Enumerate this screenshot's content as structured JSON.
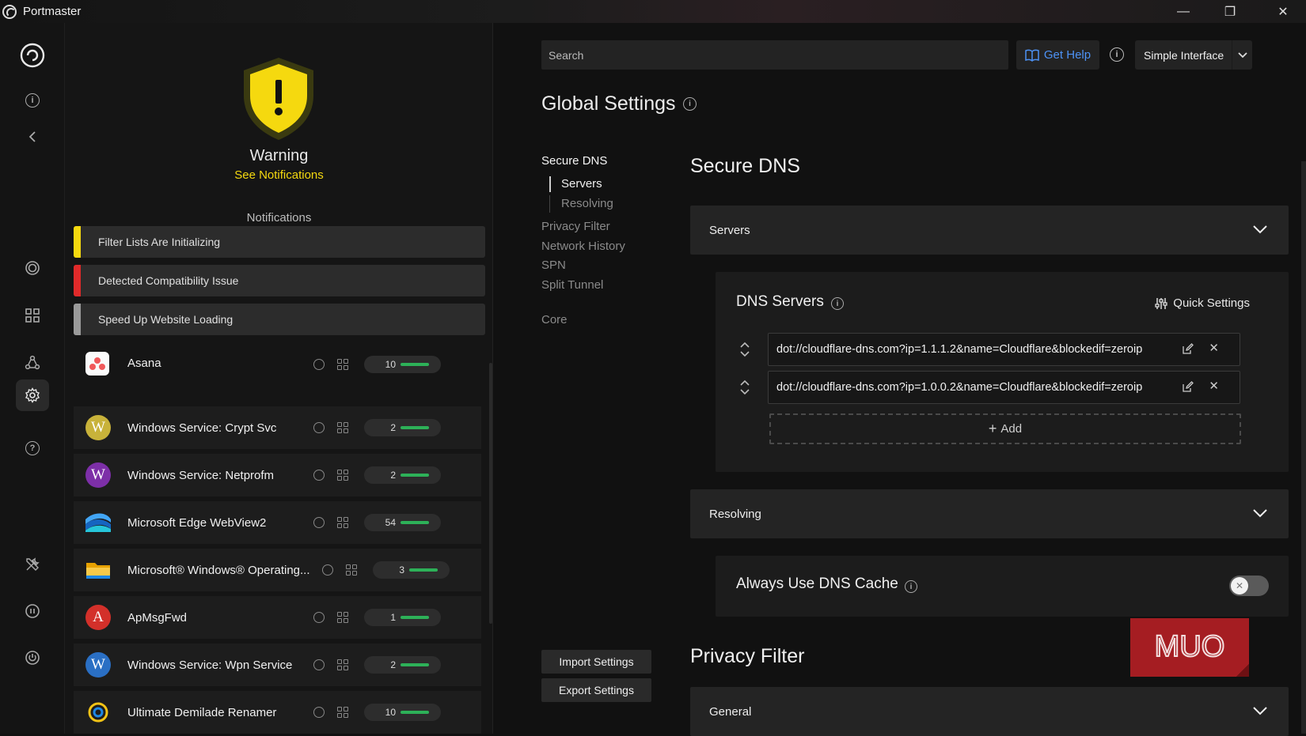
{
  "window": {
    "title": "Portmaster",
    "minimize": "—",
    "maximize": "❐",
    "close": "✕"
  },
  "rail": {
    "items": [
      {
        "name": "portmaster-logo-icon"
      },
      {
        "name": "info-icon"
      },
      {
        "name": "collapse-chevron-icon"
      },
      {
        "name": "monitor-icon"
      },
      {
        "name": "apps-icon"
      },
      {
        "name": "spn-icon"
      },
      {
        "name": "settings-gear-icon"
      },
      {
        "name": "help-icon"
      },
      {
        "name": "tools-icon"
      },
      {
        "name": "pause-icon"
      },
      {
        "name": "power-icon"
      }
    ]
  },
  "status": {
    "title": "Warning",
    "link": "See Notifications",
    "shield_color": "#f5d90f"
  },
  "notifications": {
    "heading": "Notifications",
    "items": [
      {
        "label": "Filter Lists Are Initializing",
        "color": "#f5d90f"
      },
      {
        "label": "Detected Compatibility Issue",
        "color": "#e02a2a"
      },
      {
        "label": "Speed Up Website Loading",
        "color": "#9a9a9a"
      }
    ]
  },
  "apps": [
    {
      "name": "Asana",
      "count": "10",
      "avatar": "",
      "avatar_color": "#f0f0f0"
    },
    {
      "name": "Windows Service: Crypt Svc",
      "count": "2",
      "avatar": "W",
      "avatar_color": "#c8b23a"
    },
    {
      "name": "Windows Service: Netprofm",
      "count": "2",
      "avatar": "W",
      "avatar_color": "#7d2fa8"
    },
    {
      "name": "Microsoft Edge WebView2",
      "count": "54",
      "avatar": "",
      "avatar_color": "#1e88e5"
    },
    {
      "name": "Microsoft® Windows® Operating...",
      "count": "3",
      "avatar": "",
      "avatar_color": "#f2b316"
    },
    {
      "name": "ApMsgFwd",
      "count": "1",
      "avatar": "A",
      "avatar_color": "#d3302a"
    },
    {
      "name": "Windows Service: Wpn Service",
      "count": "2",
      "avatar": "W",
      "avatar_color": "#2a6fc4"
    },
    {
      "name": "Ultimate Demilade Renamer",
      "count": "10",
      "avatar": "",
      "avatar_color": "#f2c316"
    }
  ],
  "header": {
    "search_placeholder": "Search",
    "help_label": "Get Help",
    "interface_mode": "Simple Interface"
  },
  "page": {
    "title": "Global Settings"
  },
  "toc": {
    "secure_dns": "Secure DNS",
    "servers": "Servers",
    "resolving": "Resolving",
    "privacy_filter": "Privacy Filter",
    "network_history": "Network History",
    "spn": "SPN",
    "split_tunnel": "Split Tunnel",
    "core": "Core"
  },
  "actions": {
    "import": "Import Settings",
    "export": "Export Settings"
  },
  "secure_dns": {
    "title": "Secure DNS",
    "servers_section": "Servers",
    "dns_servers_title": "DNS Servers",
    "quick_settings": "Quick Settings",
    "servers": [
      "dot://cloudflare-dns.com?ip=1.1.1.2&name=Cloudflare&blockedif=zeroip",
      "dot://cloudflare-dns.com?ip=1.0.0.2&name=Cloudflare&blockedif=zeroip"
    ],
    "add_label": "Add",
    "resolving_section": "Resolving",
    "always_use_cache": "Always Use DNS Cache",
    "always_use_cache_enabled": false
  },
  "privacy_filter": {
    "title": "Privacy Filter",
    "general_section": "General"
  },
  "watermark": {
    "text": "MUO",
    "color": "#a51d22"
  }
}
